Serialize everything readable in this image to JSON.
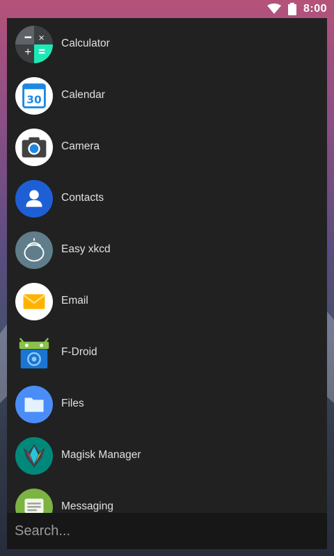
{
  "status_bar": {
    "time": "8:00",
    "icons": [
      "wifi-icon",
      "battery-icon"
    ]
  },
  "apps": [
    {
      "label": "Calculator",
      "icon": "calculator-icon"
    },
    {
      "label": "Calendar",
      "icon": "calendar-icon",
      "icon_text": "30"
    },
    {
      "label": "Camera",
      "icon": "camera-icon"
    },
    {
      "label": "Contacts",
      "icon": "contacts-icon"
    },
    {
      "label": "Easy xkcd",
      "icon": "easy-xkcd-icon"
    },
    {
      "label": "Email",
      "icon": "email-icon"
    },
    {
      "label": "F-Droid",
      "icon": "fdroid-icon"
    },
    {
      "label": "Files",
      "icon": "files-icon"
    },
    {
      "label": "Magisk Manager",
      "icon": "magisk-icon"
    },
    {
      "label": "Messaging",
      "icon": "messaging-icon"
    }
  ],
  "search": {
    "placeholder": "Search..."
  },
  "colors": {
    "panel": "#212121",
    "search_bar": "#171717",
    "label_text": "#e0e0e0"
  }
}
